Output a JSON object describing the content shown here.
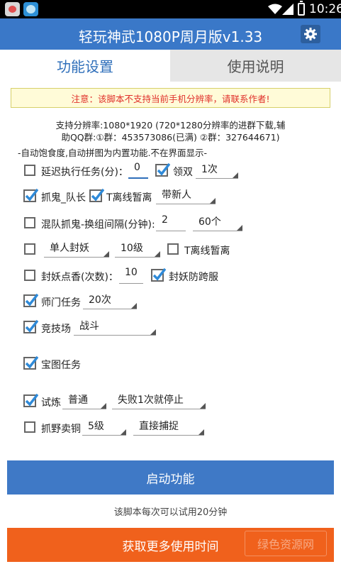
{
  "status_bar": {
    "time": "10:26"
  },
  "header": {
    "title": "轻玩神武1080P周月版v1.33"
  },
  "tabs": [
    {
      "label": "功能设置"
    },
    {
      "label": "使用说明"
    }
  ],
  "notice": "注意：该脚本不支持当前手机分辨率，请联系作者!",
  "info": {
    "line1": "支持分辨率:1080*1920 (720*1280分辨率的进群下载,辅",
    "line2": "助QQ群:①群：453573086(已满) ②群：327644671)",
    "line3": "-自动饱食度,自动拼图为内置功能.不在界面显示-"
  },
  "options": {
    "delay": {
      "label": "延迟执行任务(分)：",
      "value": "0",
      "checked": false
    },
    "double": {
      "label": "领双",
      "value": "1次",
      "checked": true
    },
    "ghost": {
      "label": "抓鬼_队长",
      "checked": true
    },
    "ghost_t": {
      "label": "T离线暂离",
      "checked": true
    },
    "ghost_mode": {
      "value": "带新人"
    },
    "mixed": {
      "label": "混队抓鬼-换组间隔(分钟):",
      "value": "2",
      "checked": false
    },
    "mixed_count": {
      "value": "60个"
    },
    "seal": {
      "checked": false,
      "mode": "单人封妖",
      "level": "10级"
    },
    "seal_t": {
      "label": "T离线暂离",
      "checked": false
    },
    "incense": {
      "label": "封妖点香(次数)：",
      "value": "10",
      "checked": false
    },
    "cross": {
      "label": "封妖防跨服",
      "checked": true
    },
    "master": {
      "label": "师门任务",
      "value": "20次",
      "checked": true
    },
    "arena": {
      "label": "竞技场",
      "value": "战斗",
      "checked": true
    },
    "treasure": {
      "label": "宝图任务",
      "checked": true
    },
    "trial": {
      "label": "试炼",
      "difficulty": "普通",
      "rule": "失败1次就停止",
      "checked": true
    },
    "wild": {
      "label": "抓野卖铜",
      "level": "5级",
      "action": "直接捕捉",
      "checked": false
    }
  },
  "buttons": {
    "start": "启动功能",
    "more": "获取更多使用时间"
  },
  "trial_note": "该脚本每次可以试用20分钟",
  "watermark": "绿色资源网",
  "colors": {
    "accent": "#3a78c8",
    "button_blue": "#3f79c6",
    "button_orange": "#f0611c",
    "notice_red": "#e0302a",
    "check_blue": "#2f8ad8"
  }
}
